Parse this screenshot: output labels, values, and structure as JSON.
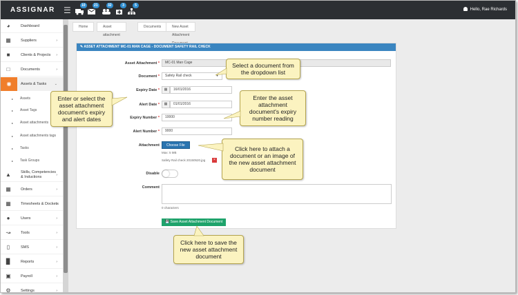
{
  "app": {
    "logo": "ASSIGNAR",
    "greeting": "Hello, Rae Richards"
  },
  "topbar": {
    "icons": [
      {
        "name": "truck-icon",
        "badge": "10"
      },
      {
        "name": "envelope-icon",
        "badge": "21"
      },
      {
        "name": "people-icon",
        "badge": "32"
      },
      {
        "name": "medkit-icon",
        "badge": "3"
      },
      {
        "name": "org-chart-icon",
        "badge": "5"
      }
    ]
  },
  "sidebar": {
    "items": [
      {
        "label": "Dashboard",
        "icon": "dashboard-icon"
      },
      {
        "label": "Suppliers",
        "icon": "sitemap-icon"
      },
      {
        "label": "Clients & Projects",
        "icon": "briefcase-icon"
      },
      {
        "label": "Documents",
        "icon": "file-icon"
      },
      {
        "label": "Assets & Tasks",
        "icon": "assets-icon"
      }
    ],
    "subitems": [
      "Assets",
      "Asset Tags",
      "Asset attachments",
      "Asset attachments tags",
      "Tasks",
      "Task Groups"
    ],
    "items2": [
      {
        "label": "Skills, Competencies & Inductions",
        "icon": "graduation-icon"
      },
      {
        "label": "Orders",
        "icon": "calendar-icon"
      },
      {
        "label": "Timesheets & Dockets",
        "icon": "table-icon"
      },
      {
        "label": "Users",
        "icon": "users-icon"
      },
      {
        "label": "Tools",
        "icon": "wrench-icon"
      },
      {
        "label": "SMS",
        "icon": "mobile-icon"
      },
      {
        "label": "Reports",
        "icon": "bar-chart-icon"
      },
      {
        "label": "Payroll",
        "icon": "money-icon"
      },
      {
        "label": "Settings",
        "icon": "gear-icon"
      }
    ]
  },
  "breadcrumb": [
    "Home",
    "Asset attachment",
    "Documents",
    "New Asset Attachment Document"
  ],
  "panel": {
    "title": "ASSET ATTACHMENT MC-01 MAN CAGE - DOCUMENT SAFETY RAIL CHECK",
    "fields": {
      "asset_attachment": {
        "label": "Asset Attachment",
        "value": "MC-01 Man Cage"
      },
      "document": {
        "label": "Document",
        "value": "Safety Rail check"
      },
      "expiry_date": {
        "label": "Expiry Date",
        "value": "16/01/2016"
      },
      "alert_date": {
        "label": "Alert Date",
        "value": "01/01/2016"
      },
      "expiry_number": {
        "label": "Expiry Number",
        "value": "10000"
      },
      "alert_number": {
        "label": "Alert Number",
        "value": "9000"
      },
      "attachment": {
        "label": "Attachment",
        "button": "Choose File",
        "max": "Max: 5 MB",
        "file": "Safety Rail check 20150520.jpg"
      },
      "disable": {
        "label": "Disable"
      },
      "comment": {
        "label": "Comment",
        "counter": "0 characters"
      }
    },
    "save_button": "Save Asset Attachment Document"
  },
  "callouts": {
    "document": "Select a document from the dropdown list",
    "dates": "Enter or select the asset attachment document's expiry and alert dates",
    "expiry_number": "Enter the asset attachment document's expiry number reading",
    "attach": "Click here to attach a document or an image of the new asset attachment document",
    "save": "Click here to save the new asset attachment document"
  },
  "colors": {
    "topbar": "#2c2f33",
    "panel_header": "#3a85c0",
    "active_item": "#f07e2b",
    "save_button": "#1ea36b",
    "callout_bg": "#fbf3c0"
  }
}
